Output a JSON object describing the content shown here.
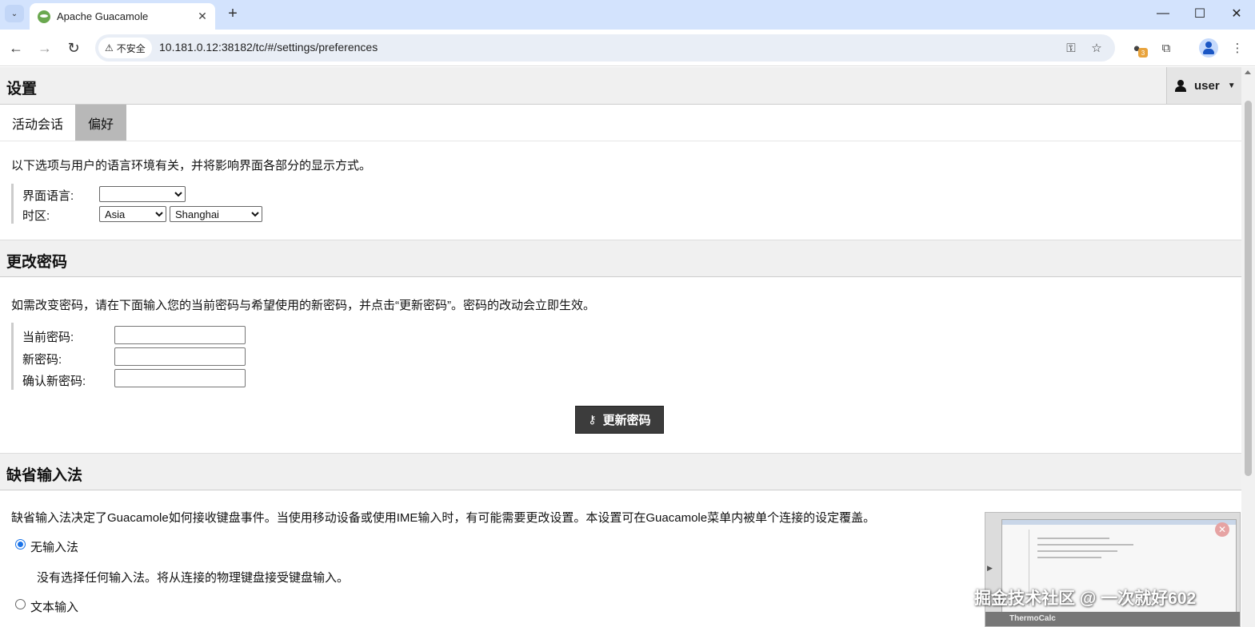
{
  "browser": {
    "tab_title": "Apache Guacamole",
    "security_label": "不安全",
    "url": "10.181.0.12:38182/tc/#/settings/preferences",
    "extension_badge": "3"
  },
  "header": {
    "title": "设置",
    "user": "user"
  },
  "tabs": [
    {
      "label": "活动会话",
      "active": false
    },
    {
      "label": "偏好",
      "active": true
    }
  ],
  "locale": {
    "description": "以下选项与用户的语言环境有关，并将影响界面各部分的显示方式。",
    "language_label": "界面语言:",
    "language_value": "",
    "timezone_label": "时区:",
    "timezone_region": "Asia",
    "timezone_city": "Shanghai"
  },
  "password": {
    "title": "更改密码",
    "description": "如需改变密码，请在下面输入您的当前密码与希望使用的新密码，并点击“更新密码”。密码的改动会立即生效。",
    "current_label": "当前密码:",
    "new_label": "新密码:",
    "confirm_label": "确认新密码:",
    "submit_label": "更新密码"
  },
  "input_method": {
    "title": "缺省输入法",
    "description": "缺省输入法决定了Guacamole如何接收键盘事件。当使用移动设备或使用IME输入时，有可能需要更改设置。本设置可在Guacamole菜单内被单个连接的设定覆盖。",
    "options": [
      {
        "label": "无输入法",
        "checked": true,
        "detail": "没有选择任何输入法。将从连接的物理键盘接受键盘输入。"
      },
      {
        "label": "文本输入",
        "checked": false
      }
    ]
  },
  "overlay": {
    "thumbnail_caption": "ThermoCalc",
    "watermark": "掘金技术社区 @ 一次就好602"
  }
}
